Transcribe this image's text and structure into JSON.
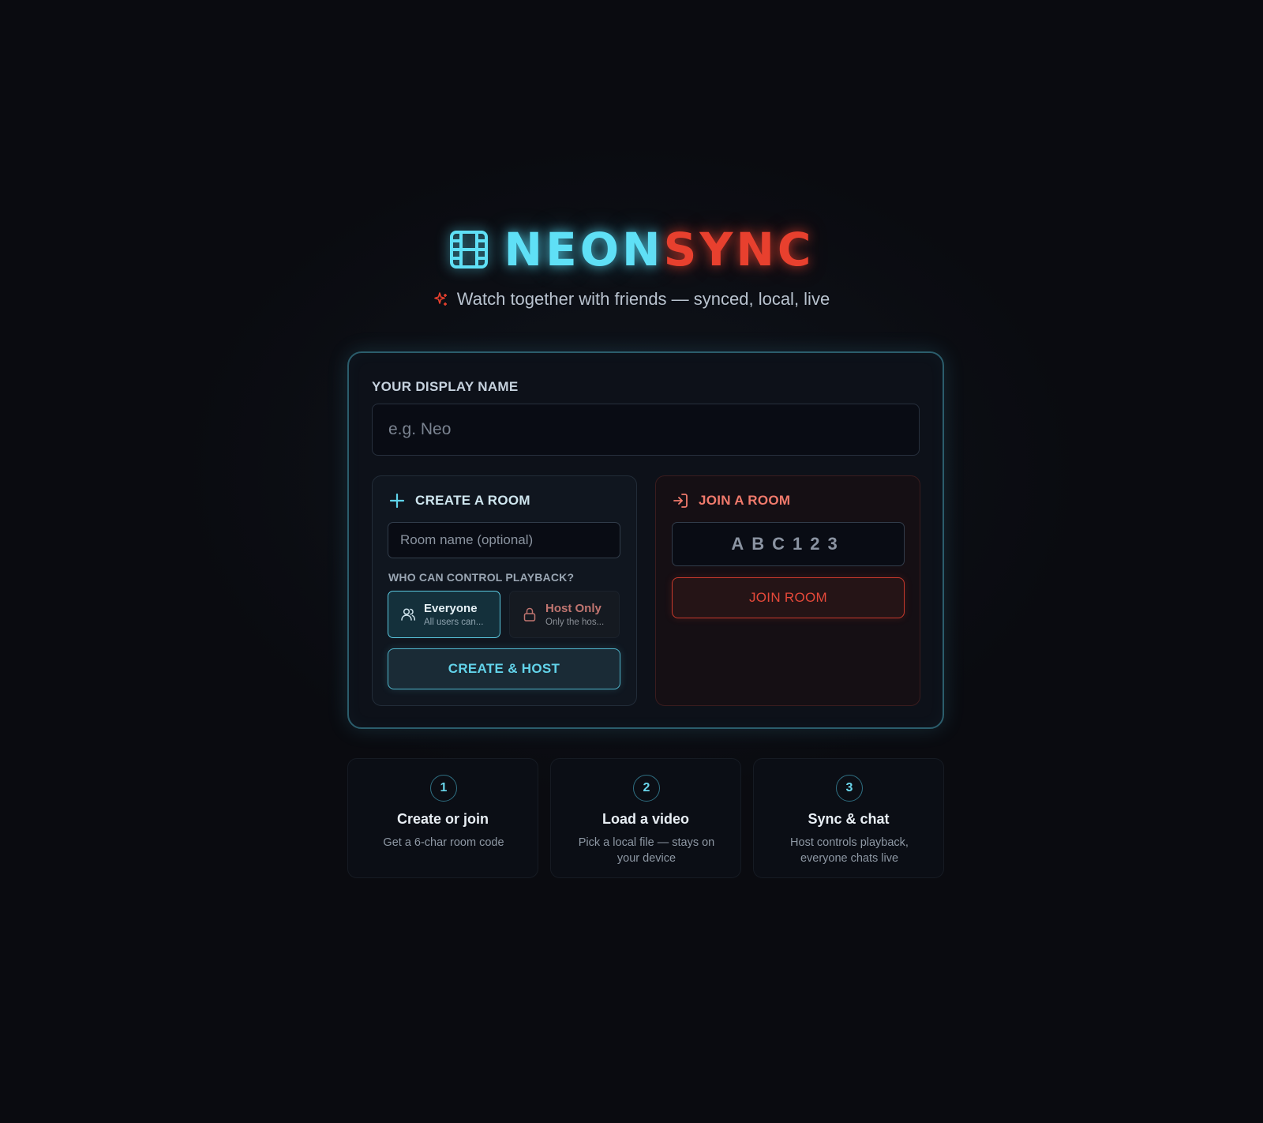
{
  "brand": {
    "name_part1": "NEON",
    "name_part2": "SYNC",
    "icon": "film-icon",
    "tagline": "Watch together with friends — synced, local, live",
    "tagline_icon": "sparkle-icon"
  },
  "colors": {
    "cyan": "#5fe0f6",
    "red": "#e8402e",
    "background": "#0a0b10"
  },
  "display_name": {
    "label": "YOUR DISPLAY NAME",
    "placeholder": "e.g. Neo",
    "value": ""
  },
  "create_room": {
    "title": "CREATE A ROOM",
    "icon": "plus-icon",
    "room_name_placeholder": "Room name (optional)",
    "room_name_value": "",
    "playback_label": "WHO CAN CONTROL PLAYBACK?",
    "options": [
      {
        "title": "Everyone",
        "subtitle": "All users can...",
        "icon": "users-icon",
        "selected": true
      },
      {
        "title": "Host Only",
        "subtitle": "Only the hos...",
        "icon": "lock-icon",
        "selected": false
      }
    ],
    "button_label": "CREATE & HOST"
  },
  "join_room": {
    "title": "JOIN A ROOM",
    "icon": "login-arrow-icon",
    "code_placeholder": "ABC123",
    "code_value": "",
    "button_label": "JOIN ROOM"
  },
  "steps": [
    {
      "number": "1",
      "title": "Create or join",
      "description": "Get a 6-char room code"
    },
    {
      "number": "2",
      "title": "Load a video",
      "description": "Pick a local file — stays on your device"
    },
    {
      "number": "3",
      "title": "Sync & chat",
      "description": "Host controls playback, everyone chats live"
    }
  ]
}
